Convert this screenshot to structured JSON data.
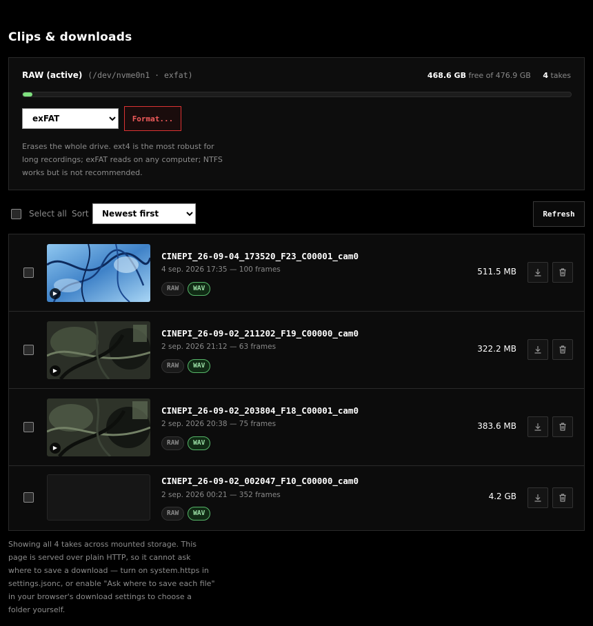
{
  "page": {
    "title": "Clips & downloads"
  },
  "drive": {
    "name": "RAW (active)",
    "device": "(/dev/nvme0n1 · exfat)",
    "free_value": "468.6 GB",
    "free_suffix": "free of 476.9 GB",
    "takes_count": "4",
    "takes_label": "takes",
    "used_fraction": 0.0174,
    "fs_selected": "exFAT",
    "format_label": "Format...",
    "help": "Erases the whole drive. ext4 is the most robust for long recordings; exFAT reads on any computer; NTFS works but is not recommended."
  },
  "toolbar": {
    "select_all": "Select all",
    "sort_label": "Sort",
    "sort_selected": "Newest first",
    "refresh": "Refresh"
  },
  "clips": [
    {
      "name": "CINEPI_26-09-04_173520_F23_C00001_cam0",
      "meta": "4 sep. 2026 17:35 — 100 frames",
      "size": "511.5 MB",
      "badges": [
        "RAW",
        "WAV"
      ]
    },
    {
      "name": "CINEPI_26-09-02_211202_F19_C00000_cam0",
      "meta": "2 sep. 2026 21:12 — 63 frames",
      "size": "322.2 MB",
      "badges": [
        "RAW",
        "WAV"
      ]
    },
    {
      "name": "CINEPI_26-09-02_203804_F18_C00001_cam0",
      "meta": "2 sep. 2026 20:38 — 75 frames",
      "size": "383.6 MB",
      "badges": [
        "RAW",
        "WAV"
      ]
    },
    {
      "name": "CINEPI_26-09-02_002047_F10_C00000_cam0",
      "meta": "2 sep. 2026 00:21 — 352 frames",
      "size": "4.2 GB",
      "badges": [
        "RAW",
        "WAV"
      ]
    }
  ],
  "icons": {
    "play": "play-icon",
    "download": "download-icon",
    "delete": "trash-icon"
  },
  "colors": {
    "accent_green": "#7ee07e",
    "danger": "#f05b5b"
  },
  "footer": "Showing all 4 takes across mounted storage. This page is served over plain HTTP, so it cannot ask where to save a download — turn on system.https in settings.jsonc, or enable \"Ask where to save each file\" in your browser's download settings to choose a folder yourself."
}
